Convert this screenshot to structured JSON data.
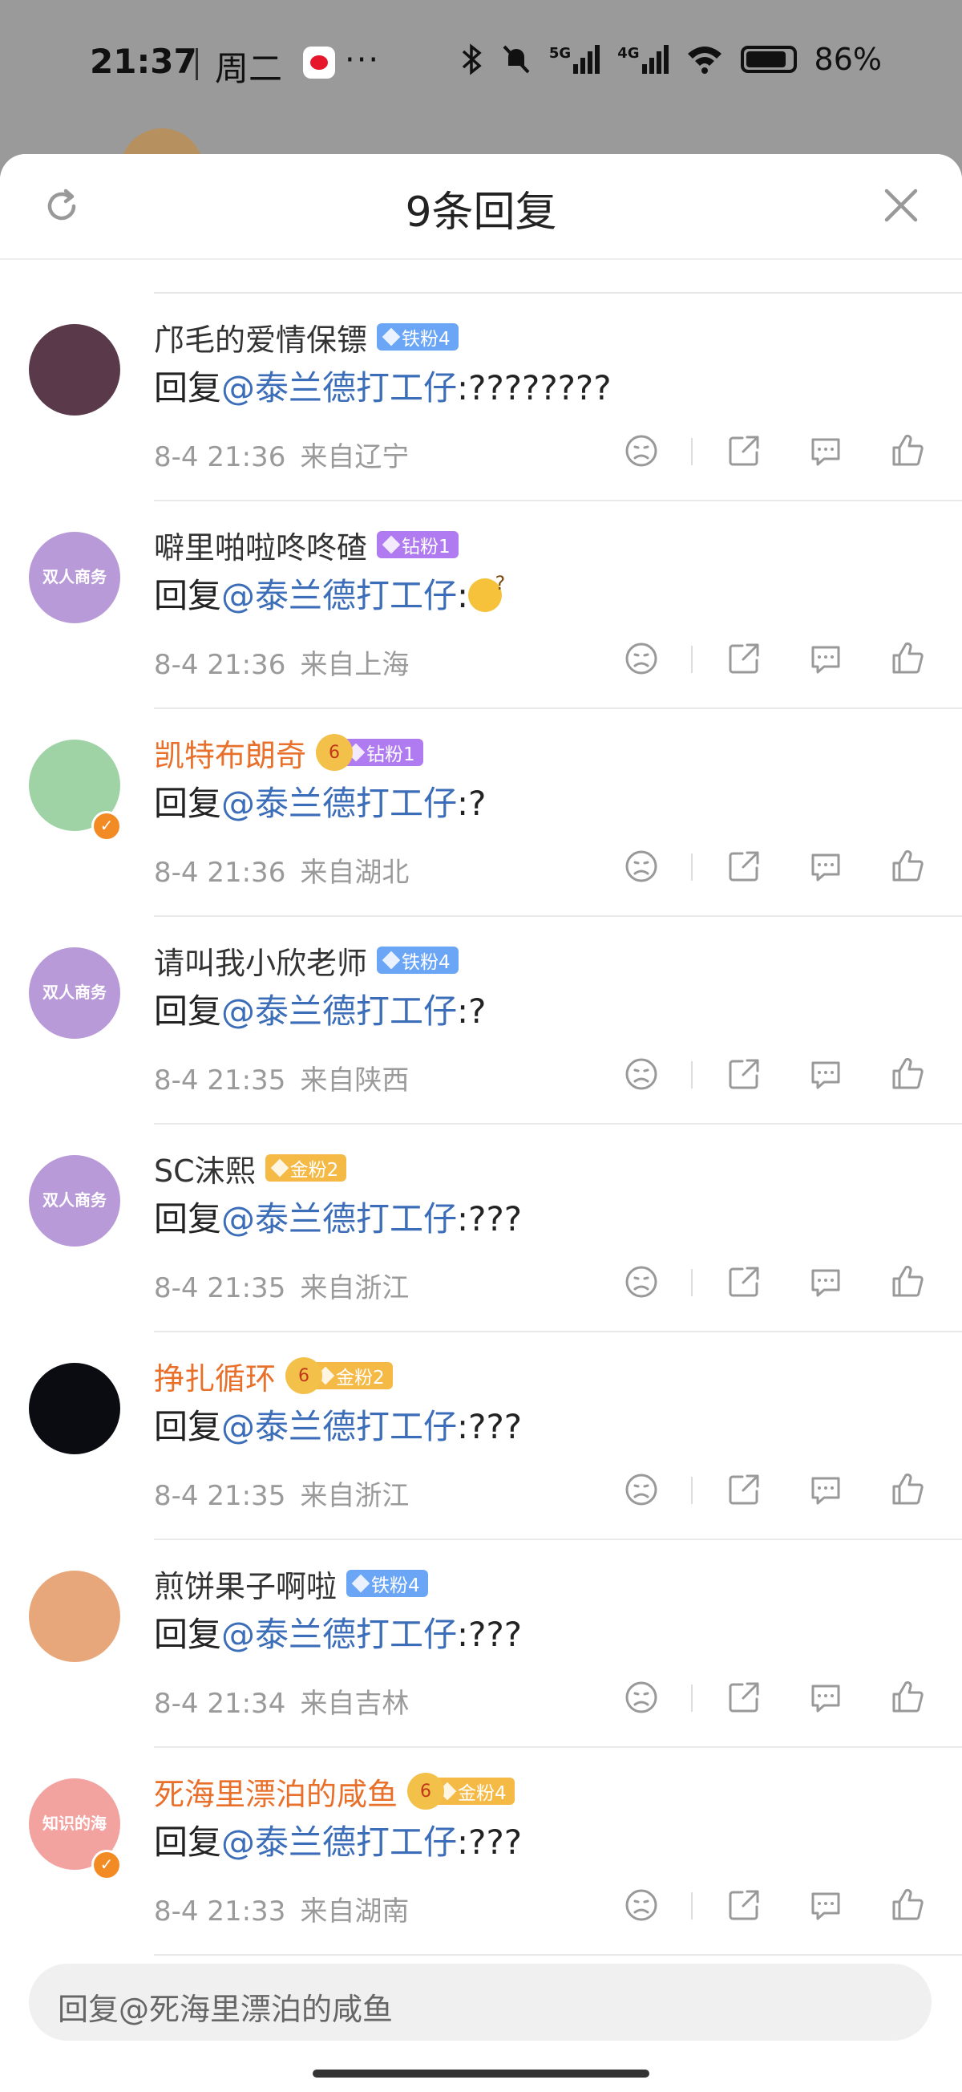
{
  "status_bar": {
    "time": "21:37",
    "weekday": "周二",
    "more": "···",
    "network_5g": "5G",
    "network_4g": "4G",
    "battery": "86%"
  },
  "sheet": {
    "title": "9条回复"
  },
  "comments": [
    {
      "name": "邝毛的爱情保镖",
      "name_style": "normal",
      "badge": "铁粉4",
      "badge_type": "iron",
      "crown": false,
      "reply_prefix": "回复",
      "mention": "@泰兰德打工仔",
      "text": ":????????",
      "date": "8-4 21:36",
      "location": "来自辽宁",
      "avatar_color": "#5a3a4a"
    },
    {
      "name": "噼里啪啦咚咚碴",
      "name_style": "normal",
      "badge": "钻粉1",
      "badge_type": "diamond",
      "crown": false,
      "reply_prefix": "回复",
      "mention": "@泰兰德打工仔",
      "text": ":",
      "emoji": "thinking-face",
      "date": "8-4 21:36",
      "location": "来自上海",
      "avatar_color": "#b89ad8",
      "avatar_text": "双人商务"
    },
    {
      "name": "凯特布朗奇",
      "name_style": "orange",
      "badge": "钻粉1",
      "badge_type": "diamond",
      "crown": true,
      "crown_level": "6",
      "verified": true,
      "reply_prefix": "回复",
      "mention": "@泰兰德打工仔",
      "text": ":?",
      "date": "8-4 21:36",
      "location": "来自湖北",
      "avatar_color": "#9fd3a6"
    },
    {
      "name": "请叫我小欣老师",
      "name_style": "normal",
      "badge": "铁粉4",
      "badge_type": "iron",
      "crown": false,
      "reply_prefix": "回复",
      "mention": "@泰兰德打工仔",
      "text": ":?",
      "date": "8-4 21:35",
      "location": "来自陕西",
      "avatar_color": "#b89ad8",
      "avatar_text": "双人商务"
    },
    {
      "name": "SC沫熙",
      "name_style": "normal",
      "badge": "金粉2",
      "badge_type": "gold",
      "crown": false,
      "reply_prefix": "回复",
      "mention": "@泰兰德打工仔",
      "text": ":???",
      "date": "8-4 21:35",
      "location": "来自浙江",
      "avatar_color": "#b89ad8",
      "avatar_text": "双人商务"
    },
    {
      "name": "挣扎循环",
      "name_style": "orange",
      "badge": "金粉2",
      "badge_type": "gold",
      "crown": true,
      "crown_level": "6",
      "reply_prefix": "回复",
      "mention": "@泰兰德打工仔",
      "text": ":???",
      "date": "8-4 21:35",
      "location": "来自浙江",
      "avatar_color": "#0a0c12"
    },
    {
      "name": "煎饼果子啊啦",
      "name_style": "normal",
      "badge": "铁粉4",
      "badge_type": "iron",
      "crown": false,
      "reply_prefix": "回复",
      "mention": "@泰兰德打工仔",
      "text": ":???",
      "date": "8-4 21:34",
      "location": "来自吉林",
      "avatar_color": "#e8a77a"
    },
    {
      "name": "死海里漂泊的咸鱼",
      "name_style": "orange",
      "badge": "金粉4",
      "badge_type": "gold",
      "crown": true,
      "crown_level": "6",
      "verified": true,
      "reply_prefix": "回复",
      "mention": "@泰兰德打工仔",
      "text": ":???",
      "date": "8-4 21:33",
      "location": "来自湖南",
      "avatar_color": "#f2a3a0",
      "avatar_text": "知识的海"
    }
  ],
  "input": {
    "placeholder": "回复@死海里漂泊的咸鱼"
  },
  "colors": {
    "accent_orange": "#e8702a",
    "mention_blue": "#3c6db8",
    "badge_iron": "#6aa6f5",
    "badge_diamond": "#b07af0",
    "badge_gold": "#f5b945"
  }
}
